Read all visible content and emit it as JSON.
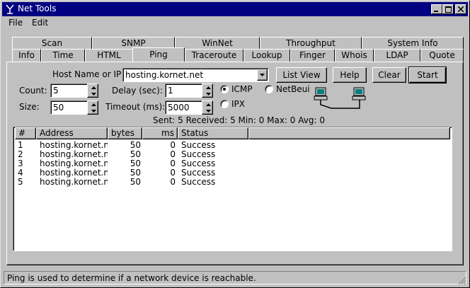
{
  "window": {
    "title": "Net Tools"
  },
  "menu": {
    "file": "File",
    "edit": "Edit"
  },
  "tabs_row1": [
    "Scan",
    "SNMP",
    "WinNet",
    "Throughput",
    "System Info"
  ],
  "tabs_row2": [
    "Info",
    "Time",
    "HTML",
    "Ping",
    "Traceroute",
    "Lookup",
    "Finger",
    "Whois",
    "LDAP",
    "Quote"
  ],
  "active_tab": "Ping",
  "form": {
    "host_label": "Host Name or IP",
    "host_value": "hosting.kornet.net",
    "count_label": "Count:",
    "count_value": "5",
    "size_label": "Size:",
    "size_value": "50",
    "delay_label": "Delay (sec):",
    "delay_value": "1",
    "timeout_label": "Timeout (ms):",
    "timeout_value": "5000",
    "protocols": {
      "icmp": "ICMP",
      "netbeui": "NetBeui",
      "ipx": "IPX",
      "selected": "ICMP"
    }
  },
  "buttons": {
    "list_view": "List View",
    "help": "Help",
    "clear": "Clear",
    "start": "Start"
  },
  "summary": "Sent: 5 Received: 5  Min: 0 Max: 0 Avg: 0",
  "table": {
    "columns": [
      "#",
      "Address",
      "bytes",
      "ms",
      "Status"
    ],
    "rows": [
      [
        "1",
        "hosting.kornet.ne",
        "50",
        "0",
        "Success"
      ],
      [
        "2",
        "hosting.kornet.ne",
        "50",
        "0",
        "Success"
      ],
      [
        "3",
        "hosting.kornet.ne",
        "50",
        "0",
        "Success"
      ],
      [
        "4",
        "hosting.kornet.ne",
        "50",
        "0",
        "Success"
      ],
      [
        "5",
        "hosting.kornet.ne",
        "50",
        "0",
        "Success"
      ]
    ]
  },
  "status_bar": "Ping is used to determine if a network device is reachable.",
  "colors": {
    "titlebar": "#000080",
    "face": "#c0c0c0"
  }
}
